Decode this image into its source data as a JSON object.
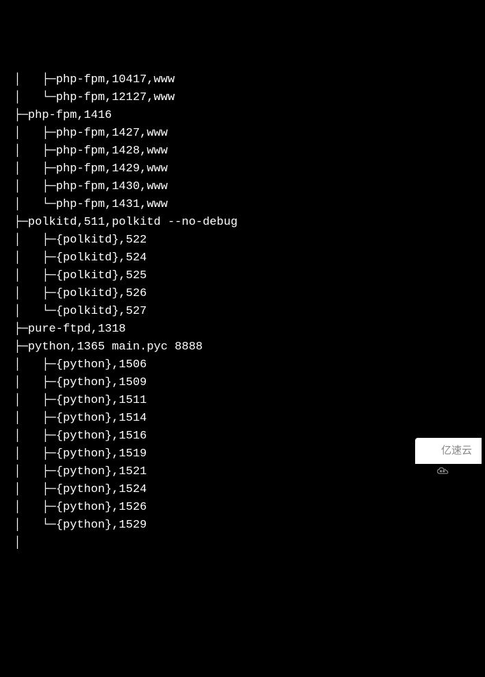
{
  "lines": [
    "  │   ├─php-fpm,10417,www",
    "  │   └─php-fpm,12127,www",
    "  ├─php-fpm,1416",
    "  │   ├─php-fpm,1427,www",
    "  │   ├─php-fpm,1428,www",
    "  │   ├─php-fpm,1429,www",
    "  │   ├─php-fpm,1430,www",
    "  │   └─php-fpm,1431,www",
    "  ├─polkitd,511,polkitd --no-debug",
    "  │   ├─{polkitd},522",
    "  │   ├─{polkitd},524",
    "  │   ├─{polkitd},525",
    "  │   ├─{polkitd},526",
    "  │   └─{polkitd},527",
    "  ├─pure-ftpd,1318",
    "  ├─python,1365 main.pyc 8888",
    "  │   ├─{python},1506",
    "  │   ├─{python},1509",
    "  │   ├─{python},1511",
    "  │   ├─{python},1514",
    "  │   ├─{python},1516",
    "  │   ├─{python},1519",
    "  │   ├─{python},1521",
    "  │   ├─{python},1524",
    "  │   ├─{python},1526",
    "  │   └─{python},1529",
    "  │"
  ],
  "watermark": {
    "text": "亿速云"
  }
}
